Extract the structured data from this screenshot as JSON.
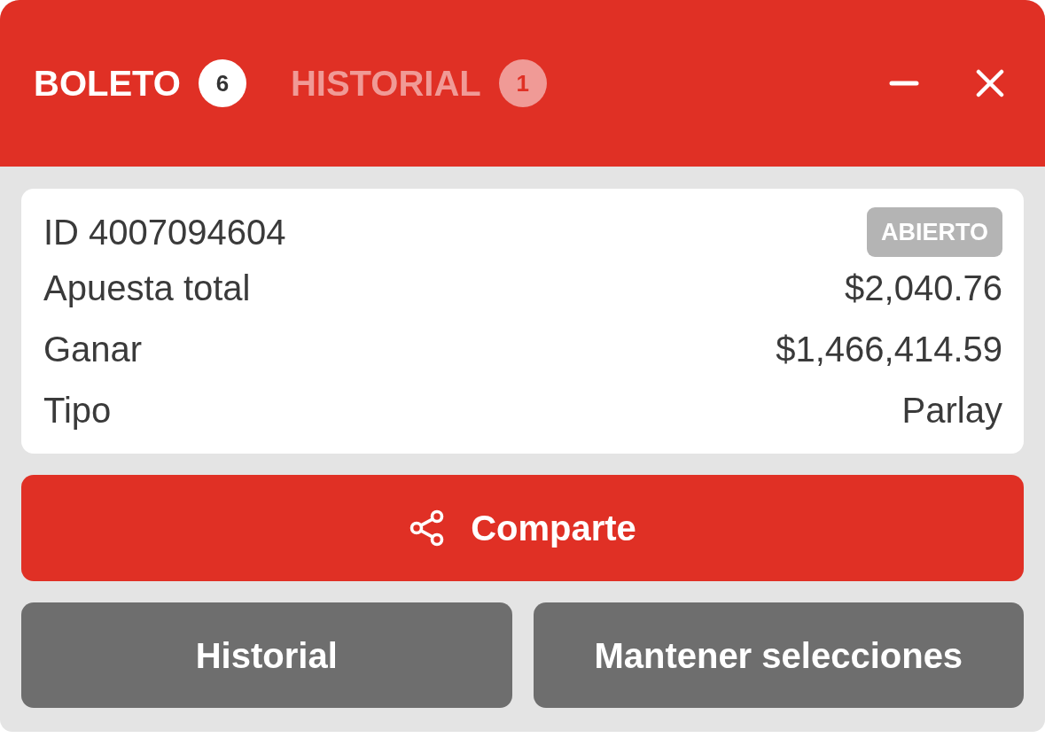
{
  "tabs": [
    {
      "label": "BOLETO",
      "count": "6",
      "selected": true
    },
    {
      "label": "HISTORIAL",
      "count": "1",
      "selected": false
    }
  ],
  "ticket": {
    "id": "ID 4007094604",
    "status": "ABIERTO",
    "rows": [
      {
        "label": "Apuesta total",
        "value": "$2,040.76"
      },
      {
        "label": "Ganar",
        "value": "$1,466,414.59"
      },
      {
        "label": "Tipo",
        "value": "Parlay"
      }
    ]
  },
  "share_button": {
    "label": "Comparte"
  },
  "buttons": [
    {
      "label": "Historial"
    },
    {
      "label": "Mantener selecciones"
    }
  ]
}
